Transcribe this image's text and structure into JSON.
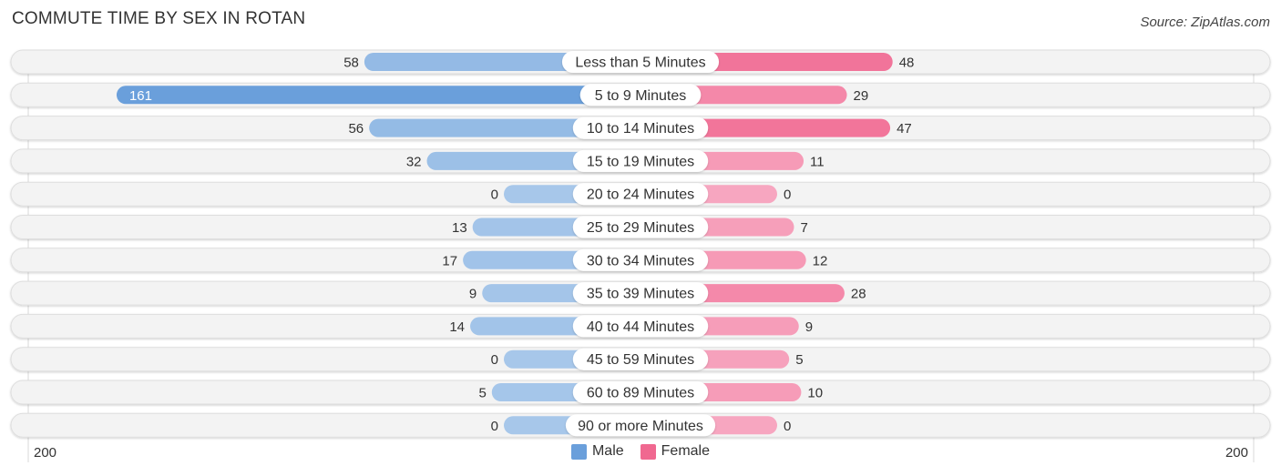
{
  "title": "COMMUTE TIME BY SEX IN ROTAN",
  "source": "Source: ZipAtlas.com",
  "colors": {
    "male_strong": "#6a9fdb",
    "male_light": "#a7c7ea",
    "female_strong": "#f06890",
    "female_light": "#f7a6c0",
    "row_bg": "#f3f3f3",
    "row_border": "#dedede"
  },
  "chart_data": {
    "type": "bar",
    "orientation": "horizontal-diverging",
    "title": "COMMUTE TIME BY SEX IN ROTAN",
    "categories": [
      "Less than 5 Minutes",
      "5 to 9 Minutes",
      "10 to 14 Minutes",
      "15 to 19 Minutes",
      "20 to 24 Minutes",
      "25 to 29 Minutes",
      "30 to 34 Minutes",
      "35 to 39 Minutes",
      "40 to 44 Minutes",
      "45 to 59 Minutes",
      "60 to 89 Minutes",
      "90 or more Minutes"
    ],
    "series": [
      {
        "name": "Male",
        "values": [
          58,
          161,
          56,
          32,
          0,
          13,
          17,
          9,
          14,
          0,
          5,
          0
        ]
      },
      {
        "name": "Female",
        "values": [
          48,
          29,
          47,
          11,
          0,
          7,
          12,
          28,
          9,
          5,
          10,
          0
        ]
      }
    ],
    "axis": {
      "left_label": "200",
      "right_label": "200",
      "range": [
        0,
        200
      ]
    },
    "legend": {
      "placement": "bottom-center",
      "entries": [
        "Male",
        "Female"
      ]
    }
  }
}
